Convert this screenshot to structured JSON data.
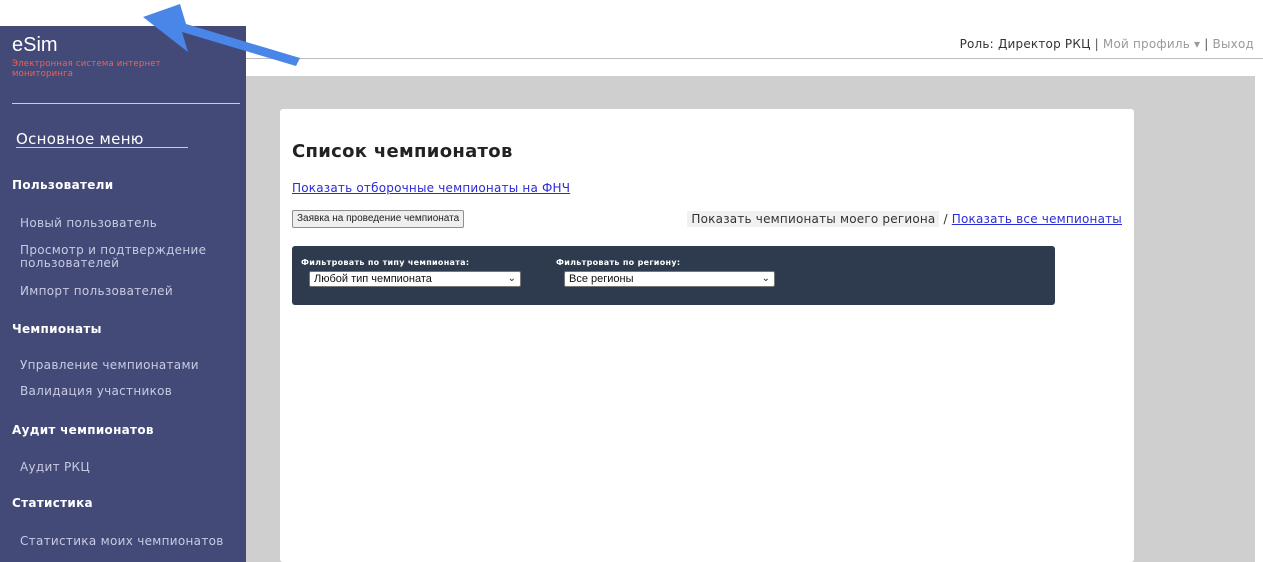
{
  "app": {
    "name": "eSim",
    "subtitle": "Электронная система интернет мониторинга"
  },
  "sidebar": {
    "menu_title": "Основное меню",
    "sections": [
      {
        "title": "Пользователи",
        "items": [
          "Новый пользователь",
          "Просмотр и подтверждение пользователей",
          "Импорт пользователей"
        ]
      },
      {
        "title": "Чемпионаты",
        "items": [
          "Управление чемпионатами",
          "Валидация участников"
        ]
      },
      {
        "title": "Аудит чемпионатов",
        "items": [
          "Аудит РКЦ"
        ]
      },
      {
        "title": "Статистика",
        "items": [
          "Статистика моих чемпионатов"
        ]
      }
    ]
  },
  "header": {
    "role": "Роль: Директор РКЦ",
    "profile": "Мой профиль",
    "profile_caret": "▾",
    "logout": "Выход",
    "separator": "|"
  },
  "main": {
    "title": "Список чемпионатов",
    "qualifier_link": "Показать отборочные чемпионаты на ФНЧ",
    "apply_button": "Заявка на проведение чемпионата",
    "my_region": "Показать чемпионаты моего региона",
    "toggle_separator": "/",
    "all_link": "Показать все чемпионаты",
    "filters": {
      "type_label": "Фильтровать по типу чемпионата:",
      "type_value": "Любой тип чемпионата",
      "region_label": "Фильтровать по региону:",
      "region_value": "Все регионы"
    }
  },
  "colors": {
    "sidebar": "#444a78",
    "accent_red": "#e8645a",
    "link": "#2b2bd9",
    "filter_panel": "#2e3a4e",
    "annotation_arrow": "#4a86e8"
  }
}
